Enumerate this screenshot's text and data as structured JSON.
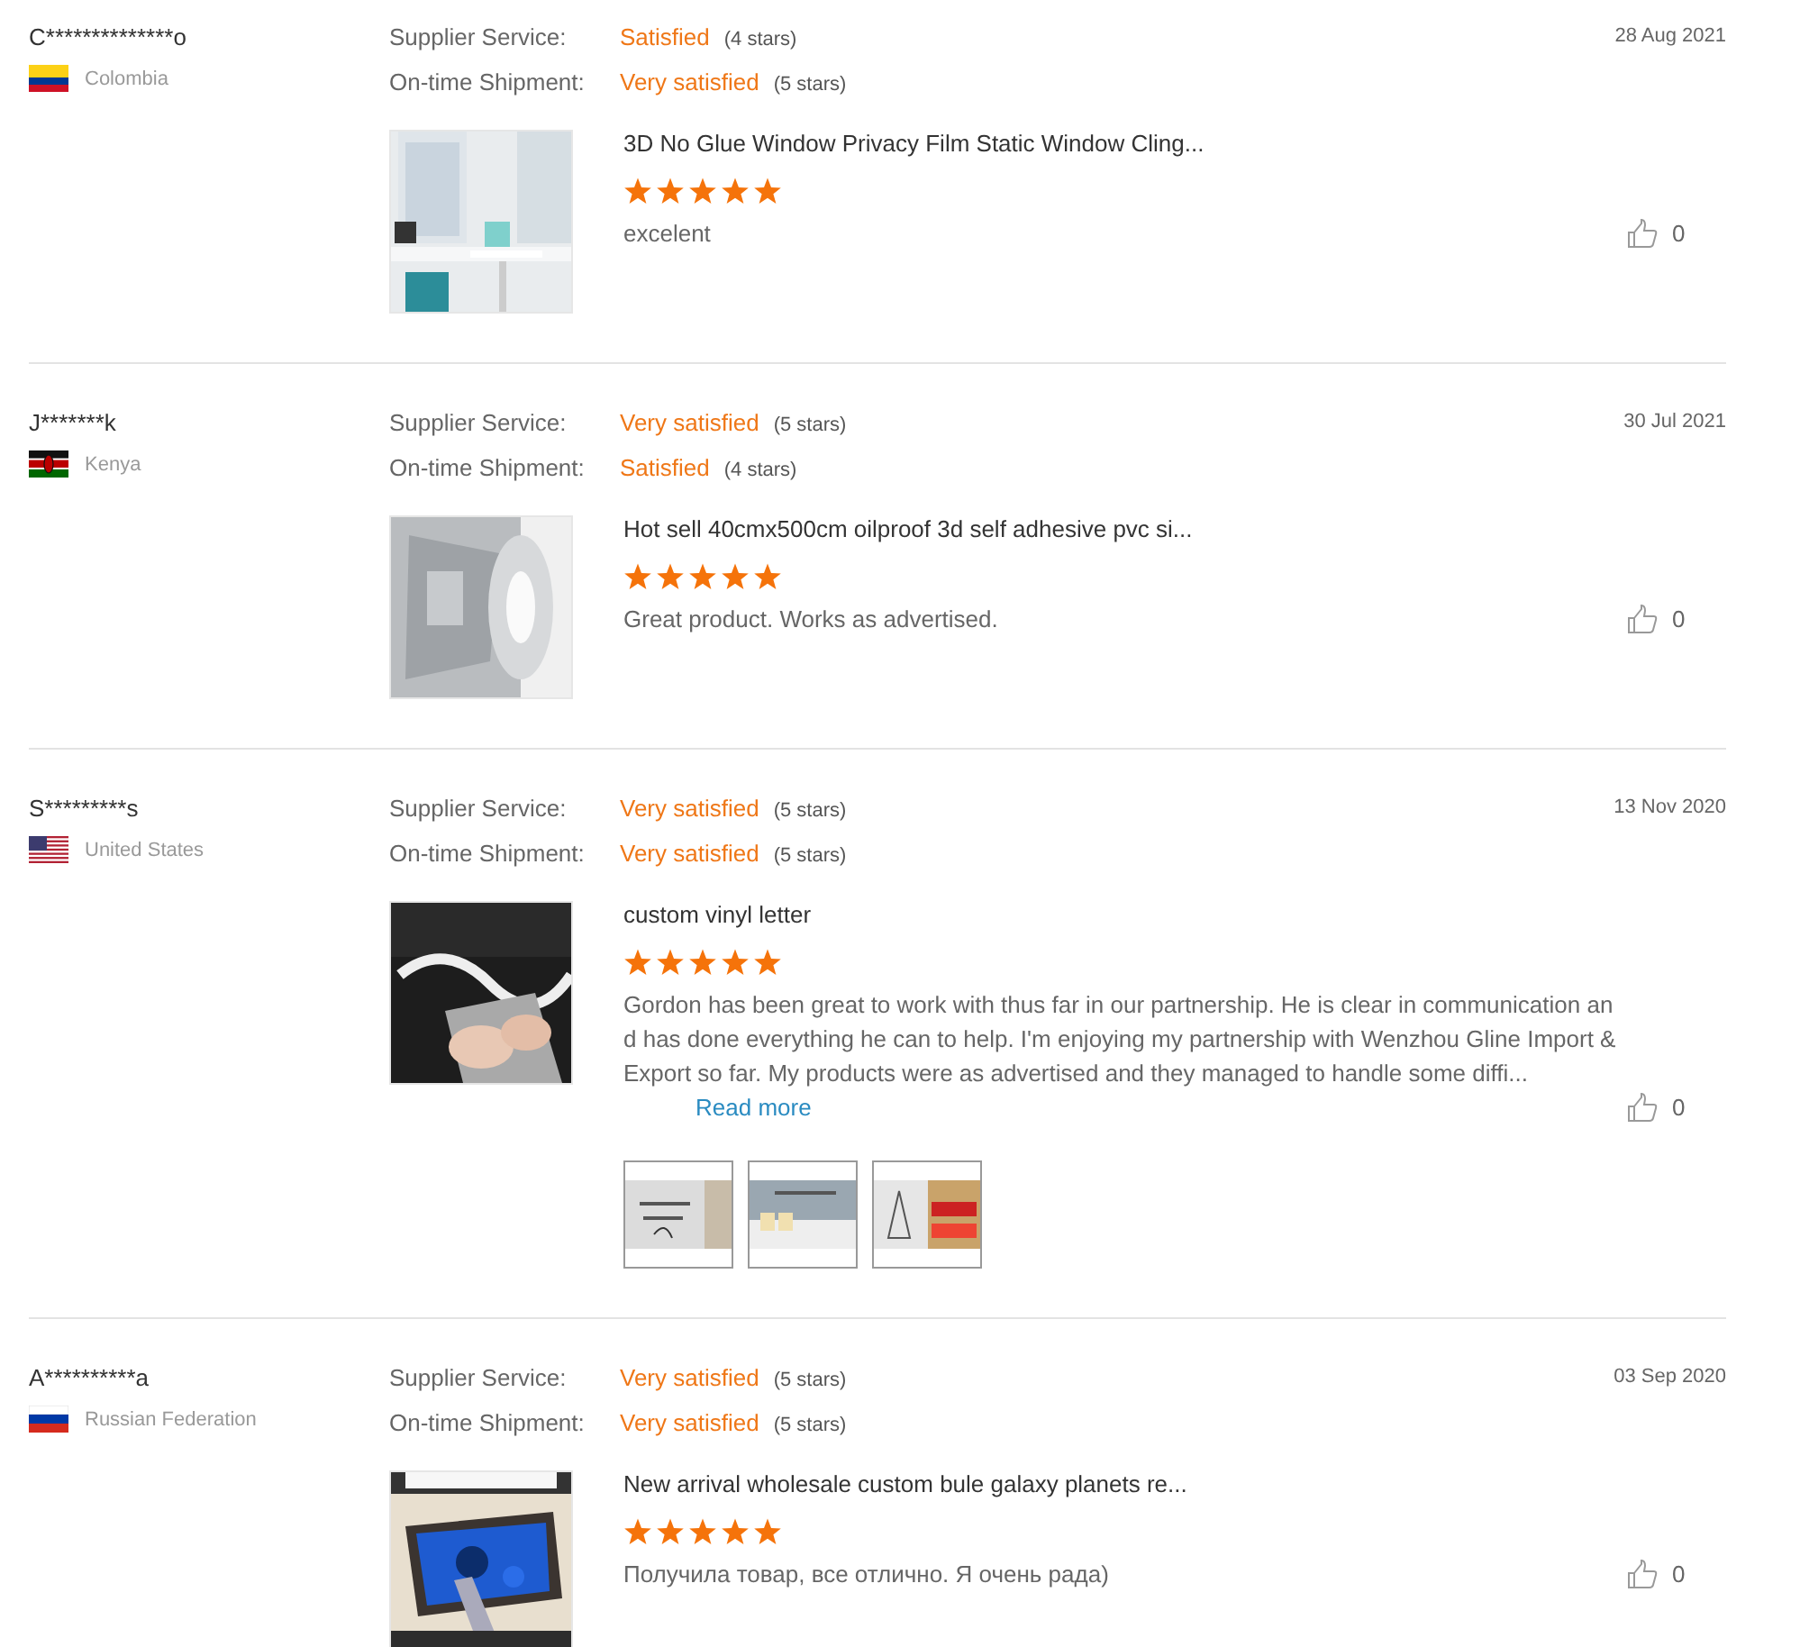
{
  "reviews": [
    {
      "buyer": "C**************o",
      "country": "Colombia",
      "date": "28 Aug 2021",
      "ratings": [
        {
          "label": "Supplier Service:",
          "value": "Satisfied",
          "stars_text": "(4 stars)"
        },
        {
          "label": "On-time Shipment:",
          "value": "Very satisfied",
          "stars_text": "(5 stars)"
        }
      ],
      "product": {
        "title": "3D No Glue Window Privacy Film Static Window Cling...",
        "stars": 5
      },
      "text": "excelent",
      "likes": "0"
    },
    {
      "buyer": "J*******k",
      "country": "Kenya",
      "date": "30 Jul 2021",
      "ratings": [
        {
          "label": "Supplier Service:",
          "value": "Very satisfied",
          "stars_text": "(5 stars)"
        },
        {
          "label": "On-time Shipment:",
          "value": "Satisfied",
          "stars_text": "(4 stars)"
        }
      ],
      "product": {
        "title": "Hot sell 40cmx500cm oilproof 3d self adhesive pvc si...",
        "stars": 5
      },
      "text": "Great product. Works as advertised.",
      "likes": "0"
    },
    {
      "buyer": "S*********s",
      "country": "United States",
      "date": "13 Nov 2020",
      "ratings": [
        {
          "label": "Supplier Service:",
          "value": "Very satisfied",
          "stars_text": "(5 stars)"
        },
        {
          "label": "On-time Shipment:",
          "value": "Very satisfied",
          "stars_text": "(5 stars)"
        }
      ],
      "product": {
        "title": "custom vinyl letter",
        "stars": 5
      },
      "text": "Gordon has been great to work with thus far in our partnership. He is clear in communication and has done everything he can to help. I'm enjoying my partnership with Wenzhou Gline Import & Export so far. My products were as advertised and they managed to handle some diffi...",
      "read_more": "Read more",
      "likes": "0",
      "attachments": [
        {
          "kind": "picture"
        },
        {
          "kind": "picture"
        },
        {
          "kind": "picture"
        }
      ]
    },
    {
      "buyer": "A**********a",
      "country": "Russian Federation",
      "date": "03 Sep 2020",
      "ratings": [
        {
          "label": "Supplier Service:",
          "value": "Very satisfied",
          "stars_text": "(5 stars)"
        },
        {
          "label": "On-time Shipment:",
          "value": "Very satisfied",
          "stars_text": "(5 stars)"
        }
      ],
      "product": {
        "title": "New arrival wholesale custom bule galaxy planets re...",
        "stars": 5
      },
      "text": "Получила товар, все отлично. Я очень рада)",
      "likes": "0"
    }
  ]
}
